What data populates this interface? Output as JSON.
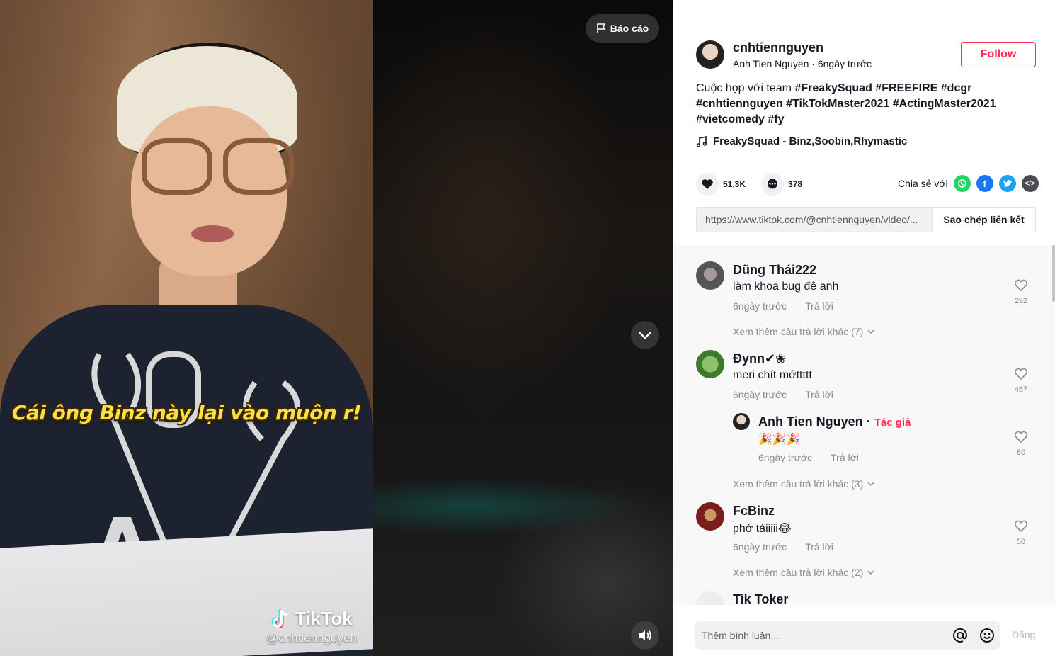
{
  "video": {
    "caption_overlay": "Cái ông Binz này lại vào muộn r!",
    "watermark_logo": "TikTok",
    "watermark_handle": "@cnhtiennguyen",
    "report_label": "Báo cáo",
    "icons": {
      "report": "flag-icon",
      "next": "chevron-down-icon",
      "volume": "speaker-icon"
    }
  },
  "author": {
    "username": "cnhtiennguyen",
    "display_name": "Anh Tien Nguyen",
    "separator": " · ",
    "posted": "6ngày trước",
    "follow_label": "Follow"
  },
  "description": {
    "text": "Cuộc họp với team",
    "tags": [
      "#FreakySquad",
      "#FREEFIRE",
      "#dcgr",
      "#cnhtiennguyen",
      "#TikTokMaster2021",
      "#ActingMaster2021",
      "#vietcomedy",
      "#fy"
    ]
  },
  "music": {
    "title": "FreakySquad - Binz,Soobin,Rhymastic",
    "icon": "music-note-icon"
  },
  "stats": {
    "likes": "51.3K",
    "comments": "378"
  },
  "share": {
    "label": "Chia sẻ với",
    "targets": [
      "whatsapp-icon",
      "facebook-icon",
      "twitter-icon",
      "embed-icon"
    ],
    "colors": {
      "whatsapp": "#25d366",
      "facebook": "#1877f2",
      "twitter": "#1da1f2",
      "embed": "#4c4c55"
    }
  },
  "link": {
    "url": "https://www.tiktok.com/@cnhtiennguyen/video/...",
    "copy_label": "Sao chép liên kết"
  },
  "comments": [
    {
      "name": "Dũng Thái222",
      "text": "làm khoa bug đê anh",
      "time": "6ngày trước",
      "reply": "Trả lời",
      "likes": "292",
      "more": "Xem thêm câu trả lời khác (7)"
    },
    {
      "name": "Đynn✔❀",
      "text": "meri chít mớttttt",
      "time": "6ngày trước",
      "reply": "Trả lời",
      "likes": "457",
      "sub": {
        "name": "Anh Tien Nguyen",
        "sep": " · ",
        "author_tag": "Tác giả",
        "text": "🎉🎉🎉",
        "time": "6ngày trước",
        "reply": "Trả lời",
        "likes": "80"
      },
      "more": "Xem thêm câu trả lời khác (3)"
    },
    {
      "name": "FcBinz",
      "text": "phở táiiiii😂",
      "time": "6ngày trước",
      "reply": "Trả lời",
      "likes": "50",
      "more": "Xem thêm câu trả lời khác (2)"
    },
    {
      "name": "Tik Toker"
    }
  ],
  "comment_bar": {
    "placeholder": "Thêm bình luận...",
    "post_label": "Đăng",
    "mention_icon": "at-icon",
    "emoji_icon": "emoji-icon"
  },
  "colors": {
    "accent": "#fe2c55",
    "caption_yellow": "#f6e141"
  }
}
